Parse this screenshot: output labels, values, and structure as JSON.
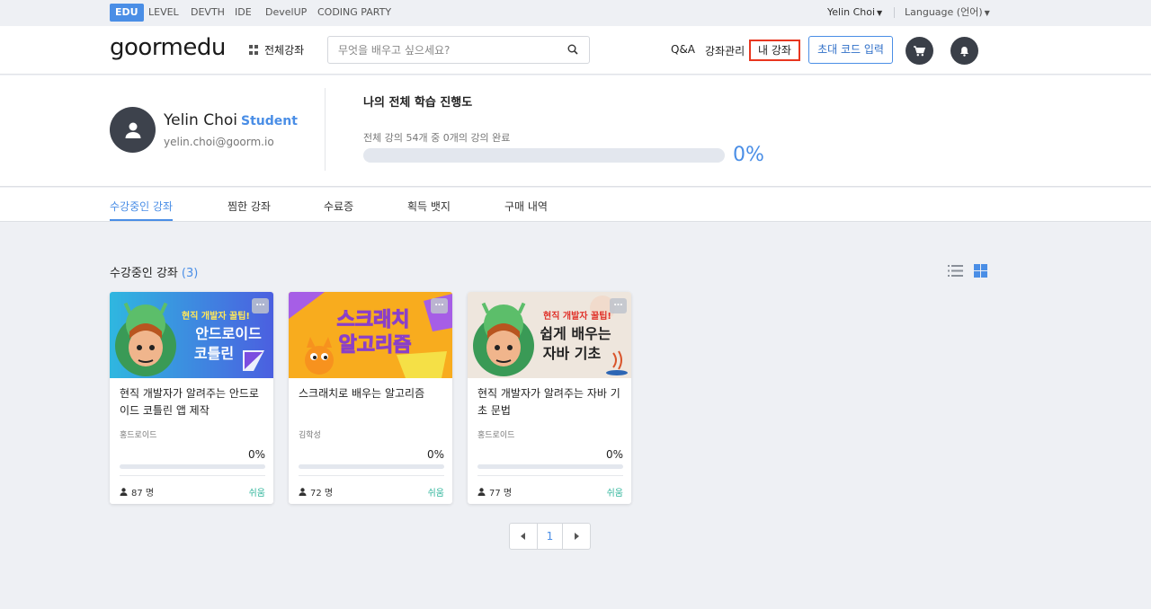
{
  "topbar": {
    "services": [
      "EDU",
      "LEVEL",
      "DEVTH",
      "IDE",
      "DevelUP",
      "CODING PARTY"
    ],
    "user": "Yelin Choi",
    "language": "Language (언어)"
  },
  "header": {
    "logo": "goormedu",
    "all_courses": "전체강좌",
    "search_placeholder": "무엇을 배우고 싶으세요?",
    "qa": "Q&A",
    "course_manage": "강좌관리",
    "my_courses": "내 강좌",
    "invite_code": "초대 코드 입력",
    "cart_icon": "cart-icon",
    "bell_icon": "bell-icon"
  },
  "profile": {
    "name": "Yelin Choi",
    "role": "Student",
    "email": "yelin.choi@goorm.io",
    "progress_title": "나의 전체 학습 진행도",
    "progress_desc": "전체 강의 54개 중 0개의 강의 완료",
    "progress_percent": "0%",
    "progress_value": 0
  },
  "tabs": [
    "수강중인 강좌",
    "찜한 강좌",
    "수료증",
    "획득 뱃지",
    "구매 내역"
  ],
  "section": {
    "title": "수강중인 강좌",
    "count": "(3)"
  },
  "courses": [
    {
      "thumb_text": [
        "현직 개발자 꿀팁!",
        "안드로이드",
        "코틀린"
      ],
      "title": "현직 개발자가 알려주는 안드로이드 코틀린 앱 제작",
      "author": "홍드로이드",
      "percent": "0%",
      "progress_value": 0,
      "students": "87 명",
      "level": "쉬움"
    },
    {
      "thumb_text": [
        "스크래치",
        "알고리즘"
      ],
      "title": "스크래치로 배우는 알고리즘",
      "author": "김학성",
      "percent": "0%",
      "progress_value": 0,
      "students": "72 명",
      "level": "쉬움"
    },
    {
      "thumb_text": [
        "현직 개발자 꿀팁!",
        "쉽게 배우는",
        "자바 기초"
      ],
      "title": "현직 개발자가 알려주는 자바 기초 문법",
      "author": "홍드로이드",
      "percent": "0%",
      "progress_value": 0,
      "students": "77 명",
      "level": "쉬움"
    }
  ],
  "pagination": {
    "current": "1"
  },
  "colors": {
    "accent": "#4a8ee6",
    "highlight_border": "#e8361f",
    "easy_level": "#2fb59b"
  }
}
